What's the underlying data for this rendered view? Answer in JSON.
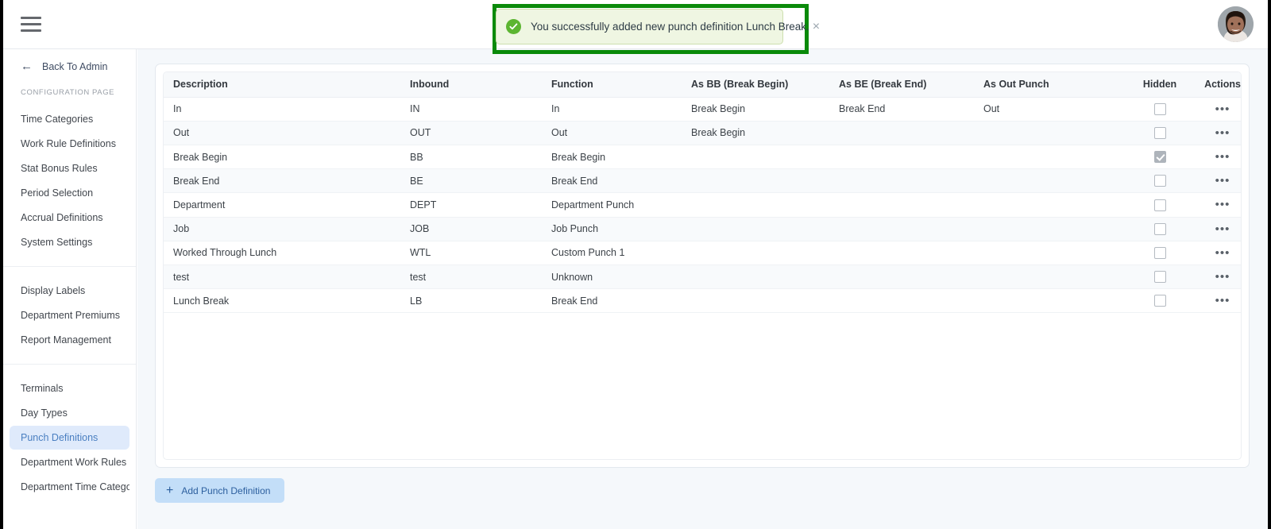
{
  "topbar": {
    "menu_icon": "hamburger-icon",
    "avatar_icon": "user-avatar"
  },
  "notification": {
    "icon": "check-circle-icon",
    "message": "You successfully added new punch definition Lunch Break.",
    "close_label": "×",
    "bg_color": "#eff6e2",
    "border_color": "#cddfae",
    "icon_color": "#5cb531",
    "highlight_color": "#0a8a0a"
  },
  "sidebar": {
    "back_label": "Back To Admin",
    "back_icon": "arrow-left-icon",
    "section_label": "CONFIGURATION PAGE",
    "groups": [
      {
        "items": [
          {
            "label": "Time Categories",
            "active": false
          },
          {
            "label": "Work Rule Definitions",
            "active": false
          },
          {
            "label": "Stat Bonus Rules",
            "active": false
          },
          {
            "label": "Period Selection",
            "active": false
          },
          {
            "label": "Accrual Definitions",
            "active": false
          },
          {
            "label": "System Settings",
            "active": false
          }
        ]
      },
      {
        "items": [
          {
            "label": "Display Labels",
            "active": false
          },
          {
            "label": "Department Premiums",
            "active": false
          },
          {
            "label": "Report Management",
            "active": false
          }
        ]
      },
      {
        "items": [
          {
            "label": "Terminals",
            "active": false
          },
          {
            "label": "Day Types",
            "active": false
          },
          {
            "label": "Punch Definitions",
            "active": true
          },
          {
            "label": "Department Work Rules Filt...",
            "active": false
          },
          {
            "label": "Department Time Category ...",
            "active": false
          }
        ]
      }
    ],
    "active_bg": "#dfeafb",
    "active_color": "#4a7fc1"
  },
  "table": {
    "columns": [
      "Description",
      "Inbound",
      "Function",
      "As BB (Break Begin)",
      "As BE (Break End)",
      "As Out Punch",
      "Hidden",
      "Actions"
    ],
    "rows": [
      {
        "description": "In",
        "inbound": "IN",
        "function": "In",
        "as_bb": "Break Begin",
        "as_be": "Break End",
        "as_out": "Out",
        "hidden": false,
        "actions": "•••"
      },
      {
        "description": "Out",
        "inbound": "OUT",
        "function": "Out",
        "as_bb": "Break Begin",
        "as_be": "",
        "as_out": "",
        "hidden": false,
        "actions": "•••"
      },
      {
        "description": "Break Begin",
        "inbound": "BB",
        "function": "Break Begin",
        "as_bb": "",
        "as_be": "",
        "as_out": "",
        "hidden": true,
        "actions": "•••"
      },
      {
        "description": "Break End",
        "inbound": "BE",
        "function": "Break End",
        "as_bb": "",
        "as_be": "",
        "as_out": "",
        "hidden": false,
        "actions": "•••"
      },
      {
        "description": "Department",
        "inbound": "DEPT",
        "function": "Department Punch",
        "as_bb": "",
        "as_be": "",
        "as_out": "",
        "hidden": false,
        "actions": "•••"
      },
      {
        "description": "Job",
        "inbound": "JOB",
        "function": "Job Punch",
        "as_bb": "",
        "as_be": "",
        "as_out": "",
        "hidden": false,
        "actions": "•••"
      },
      {
        "description": "Worked Through Lunch",
        "inbound": "WTL",
        "function": "Custom Punch 1",
        "as_bb": "",
        "as_be": "",
        "as_out": "",
        "hidden": false,
        "actions": "•••"
      },
      {
        "description": "test",
        "inbound": "test",
        "function": "Unknown",
        "as_bb": "",
        "as_be": "",
        "as_out": "",
        "hidden": false,
        "actions": "•••"
      },
      {
        "description": "Lunch Break",
        "inbound": "LB",
        "function": "Break End",
        "as_bb": "",
        "as_be": "",
        "as_out": "",
        "hidden": false,
        "actions": "•••"
      }
    ]
  },
  "footer": {
    "add_button_label": "Add Punch Definition",
    "add_button_icon": "plus-icon",
    "add_button_bg": "#c3def8",
    "add_button_color": "#2c5f9e"
  }
}
